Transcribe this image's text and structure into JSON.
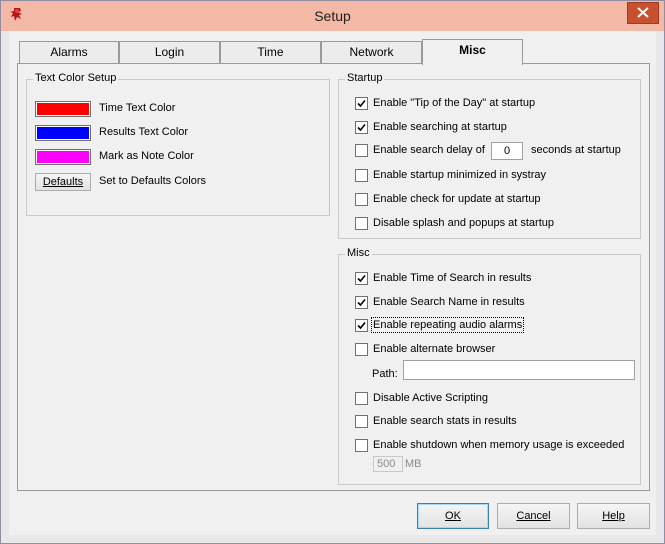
{
  "window": {
    "title": "Setup"
  },
  "tabs": [
    {
      "label": "Alarms"
    },
    {
      "label": "Login"
    },
    {
      "label": "Time"
    },
    {
      "label": "Network"
    },
    {
      "label": "Misc",
      "active": true
    }
  ],
  "text_color_setup": {
    "title": "Text Color Setup",
    "items": [
      {
        "label": "Time Text Color",
        "color": "#ff0000"
      },
      {
        "label": "Results Text Color",
        "color": "#0000ff"
      },
      {
        "label": "Mark as Note Color",
        "color": "#ff00ff"
      }
    ],
    "defaults_button": "Defaults",
    "defaults_label": "Set to Defaults Colors"
  },
  "startup": {
    "title": "Startup",
    "options": [
      {
        "label": "Enable \"Tip of the Day\" at startup",
        "checked": true
      },
      {
        "label": "Enable searching at startup",
        "checked": true
      },
      {
        "label": "Enable search delay of",
        "checked": false,
        "value": "0",
        "suffix": "seconds at startup"
      },
      {
        "label": "Enable startup minimized in systray",
        "checked": false
      },
      {
        "label": "Enable check for update at startup",
        "checked": false
      },
      {
        "label": "Disable splash and popups at startup",
        "checked": false
      }
    ]
  },
  "misc": {
    "title": "Misc",
    "options": [
      {
        "label": "Enable Time of Search in results",
        "checked": true
      },
      {
        "label": "Enable Search Name in results",
        "checked": true
      },
      {
        "label": "Enable repeating audio alarms",
        "checked": true
      },
      {
        "label": "Enable alternate browser",
        "checked": false
      },
      {
        "label": "Disable Active Scripting",
        "checked": false
      },
      {
        "label": "Enable search stats in results",
        "checked": false
      },
      {
        "label": "Enable shutdown when memory usage is exceeded",
        "checked": false
      }
    ],
    "path_label": "Path:",
    "path_value": "",
    "memory_value": "500",
    "memory_unit": "MB"
  },
  "buttons": {
    "ok": "OK",
    "cancel": "Cancel",
    "help": "Help"
  },
  "colors": {
    "titlebar": "#f3b8a6",
    "close": "#c7502f"
  }
}
